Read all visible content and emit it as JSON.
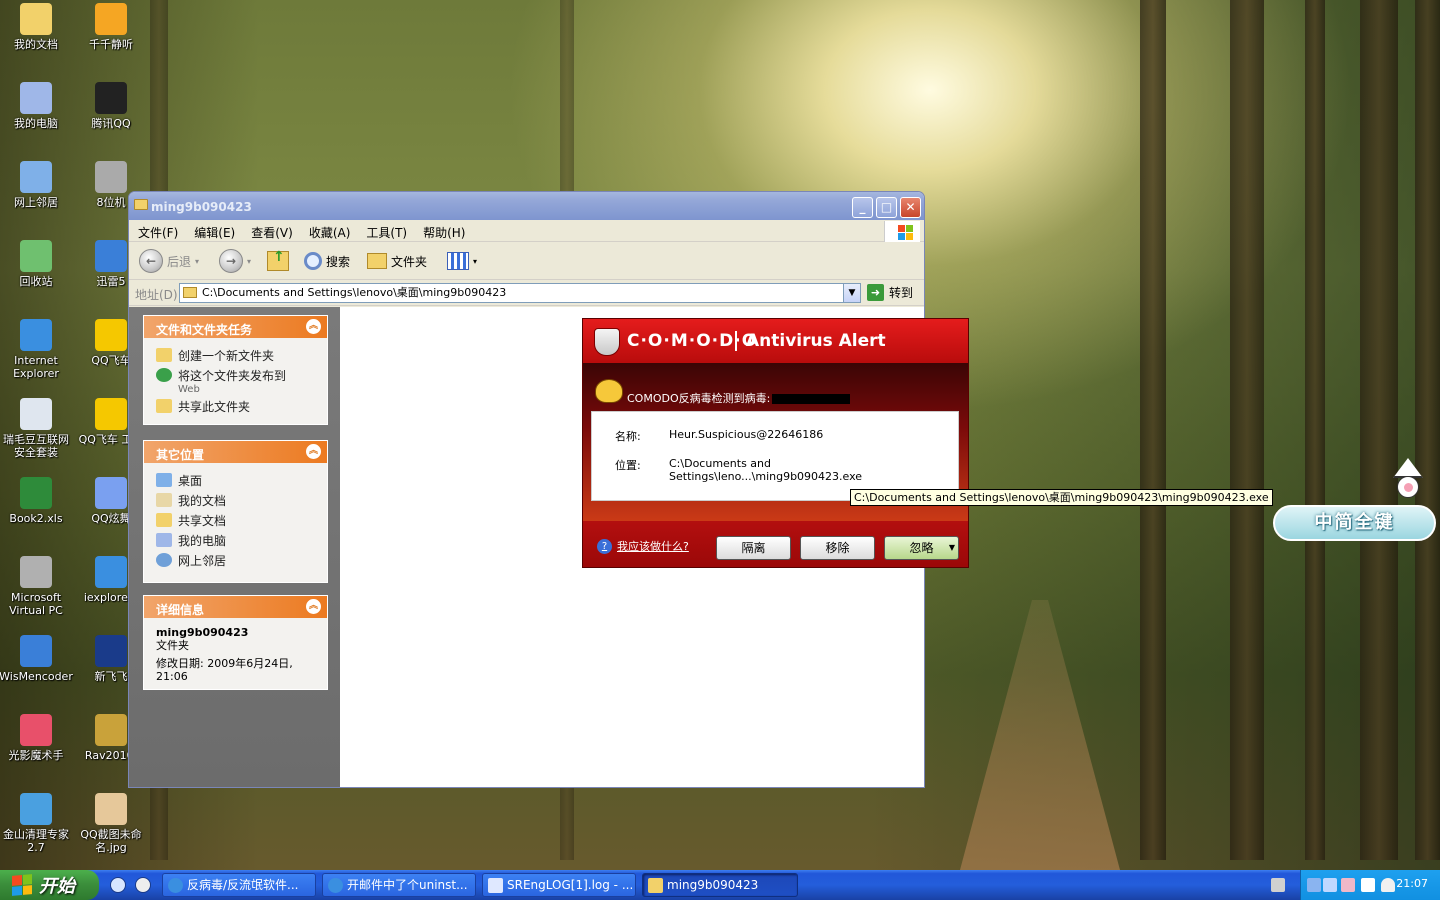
{
  "desktop": {
    "icons": [
      {
        "label": "我的文档",
        "color": "#f2d16a"
      },
      {
        "label": "千千静听",
        "color": "#f5a623"
      },
      {
        "label": "我的电脑",
        "color": "#9fb7e8"
      },
      {
        "label": "腾讯QQ",
        "color": "#222222"
      },
      {
        "label": "网上邻居",
        "color": "#7fb0e8"
      },
      {
        "label": "8位机",
        "color": "#aaaaaa"
      },
      {
        "label": "回收站",
        "color": "#6fc06f"
      },
      {
        "label": "迅雷5",
        "color": "#3a7fd8"
      },
      {
        "label": "Internet Explorer",
        "color": "#3a8fe0"
      },
      {
        "label": "QQ飞车",
        "color": "#f5c800"
      },
      {
        "label": "瑞毛豆互联网安全套装",
        "color": "#dfe6ef"
      },
      {
        "label": "QQ飞车 工具",
        "color": "#f5c800"
      },
      {
        "label": "Book2.xls",
        "color": "#2e8b3a"
      },
      {
        "label": "QQ炫舞",
        "color": "#7aa0f0"
      },
      {
        "label": "Microsoft Virtual PC",
        "color": "#b0b0b0"
      },
      {
        "label": "iexplore.e",
        "color": "#3a8fe0"
      },
      {
        "label": "WisMencoder",
        "color": "#3a7fd8"
      },
      {
        "label": "新飞飞",
        "color": "#1a3b8a"
      },
      {
        "label": "光影魔术手",
        "color": "#e8506a"
      },
      {
        "label": "Rav2010.",
        "color": "#c9a23a"
      },
      {
        "label": "金山清理专家 2.7",
        "color": "#4aa0e0"
      },
      {
        "label": "QQ截图未命名.jpg",
        "color": "#e6c89a"
      }
    ]
  },
  "window": {
    "title": "ming9b090423",
    "menu": [
      "文件(F)",
      "编辑(E)",
      "查看(V)",
      "收藏(A)",
      "工具(T)",
      "帮助(H)"
    ],
    "toolbar": {
      "back": "后退",
      "search": "搜索",
      "folders": "文件夹"
    },
    "address": {
      "label": "地址(D)",
      "path": "C:\\Documents and Settings\\lenovo\\桌面\\ming9b090423",
      "go": "转到"
    },
    "panels": {
      "tasks": {
        "title": "文件和文件夹任务",
        "items": [
          "创建一个新文件夹",
          "将这个文件夹发布到",
          "Web",
          "共享此文件夹"
        ]
      },
      "places": {
        "title": "其它位置",
        "items": [
          "桌面",
          "我的文档",
          "共享文档",
          "我的电脑",
          "网上邻居"
        ]
      },
      "details": {
        "title": "详细信息",
        "name": "ming9b090423",
        "type": "文件夹",
        "modified": "修改日期: 2009年6月24日, 21:06"
      }
    }
  },
  "alert": {
    "brand": "C·O·M·O·D·O",
    "title": "Antivirus Alert",
    "message": "COMODO反病毒检测到病毒:",
    "name_label": "名称:",
    "name_value": "Heur.Suspicious@22646186",
    "location_label": "位置:",
    "location_value": "C:\\Documents and Settings\\leno...\\ming9b090423.exe",
    "help": "我应该做什么?",
    "buttons": {
      "quarantine": "隔离",
      "remove": "移除",
      "ignore": "忽略"
    },
    "tooltip": "C:\\Documents and Settings\\lenovo\\桌面\\ming9b090423\\ming9b090423.exe"
  },
  "widget": {
    "label": "中简全键"
  },
  "taskbar": {
    "start": "开始",
    "tasks": [
      "反病毒/反流氓软件...",
      "开邮件中了个uninst...",
      "SREngLOG[1].log - ...",
      "ming9b090423"
    ],
    "clock": "21:07"
  }
}
